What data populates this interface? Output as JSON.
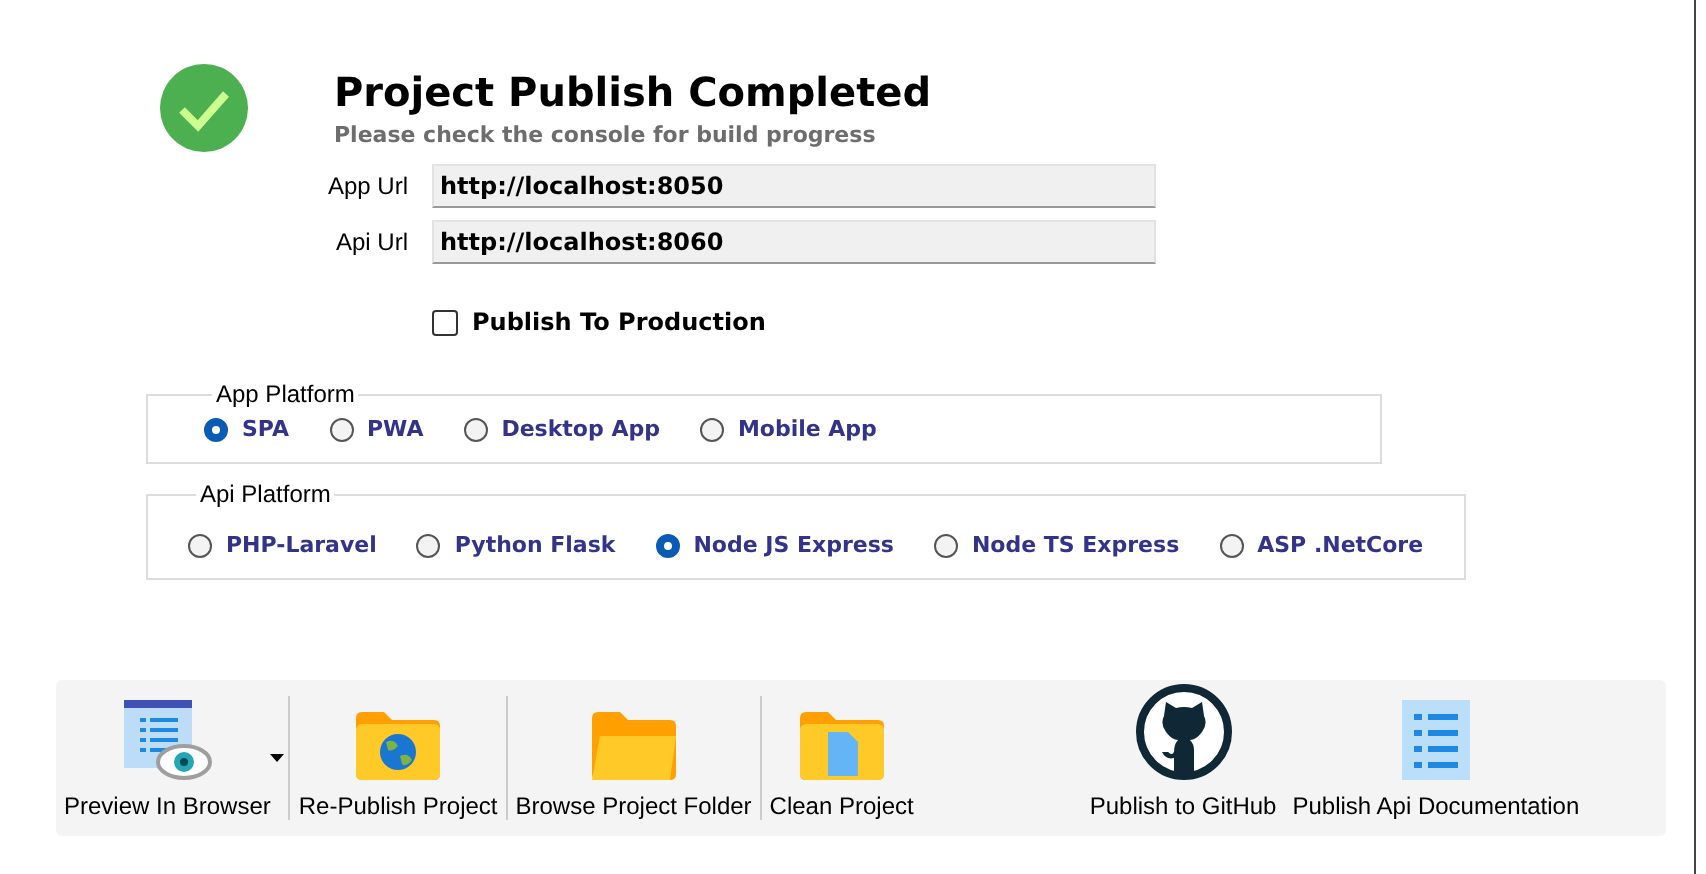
{
  "header": {
    "title": "Project Publish Completed",
    "subtitle": "Please check the console for build progress"
  },
  "fields": [
    {
      "label": "App Url",
      "value": "http://localhost:8050"
    },
    {
      "label": "Api Url",
      "value": "http://localhost:8060"
    }
  ],
  "publish_to_production": {
    "label": "Publish To Production",
    "checked": false
  },
  "groups": [
    {
      "title": "App Platform",
      "options": [
        {
          "label": "SPA",
          "selected": true
        },
        {
          "label": "PWA",
          "selected": false
        },
        {
          "label": "Desktop App",
          "selected": false
        },
        {
          "label": "Mobile App",
          "selected": false
        }
      ]
    },
    {
      "title": "Api Platform",
      "options": [
        {
          "label": "PHP-Laravel",
          "selected": false
        },
        {
          "label": "Python Flask",
          "selected": false
        },
        {
          "label": "Node JS Express",
          "selected": true
        },
        {
          "label": "Node TS Express",
          "selected": false
        },
        {
          "label": "ASP .NetCore",
          "selected": false
        }
      ]
    }
  ],
  "toolbar": [
    {
      "label": "Preview In Browser",
      "kind": "preview"
    },
    {
      "label": "Re-Publish Project",
      "kind": "globe-folder"
    },
    {
      "label": "Browse Project Folder",
      "kind": "folder"
    },
    {
      "label": "Clean Project",
      "kind": "file-folder"
    },
    {
      "label": "Publish to GitHub",
      "kind": "github"
    },
    {
      "label": "Publish Api Documentation",
      "kind": "list"
    }
  ]
}
